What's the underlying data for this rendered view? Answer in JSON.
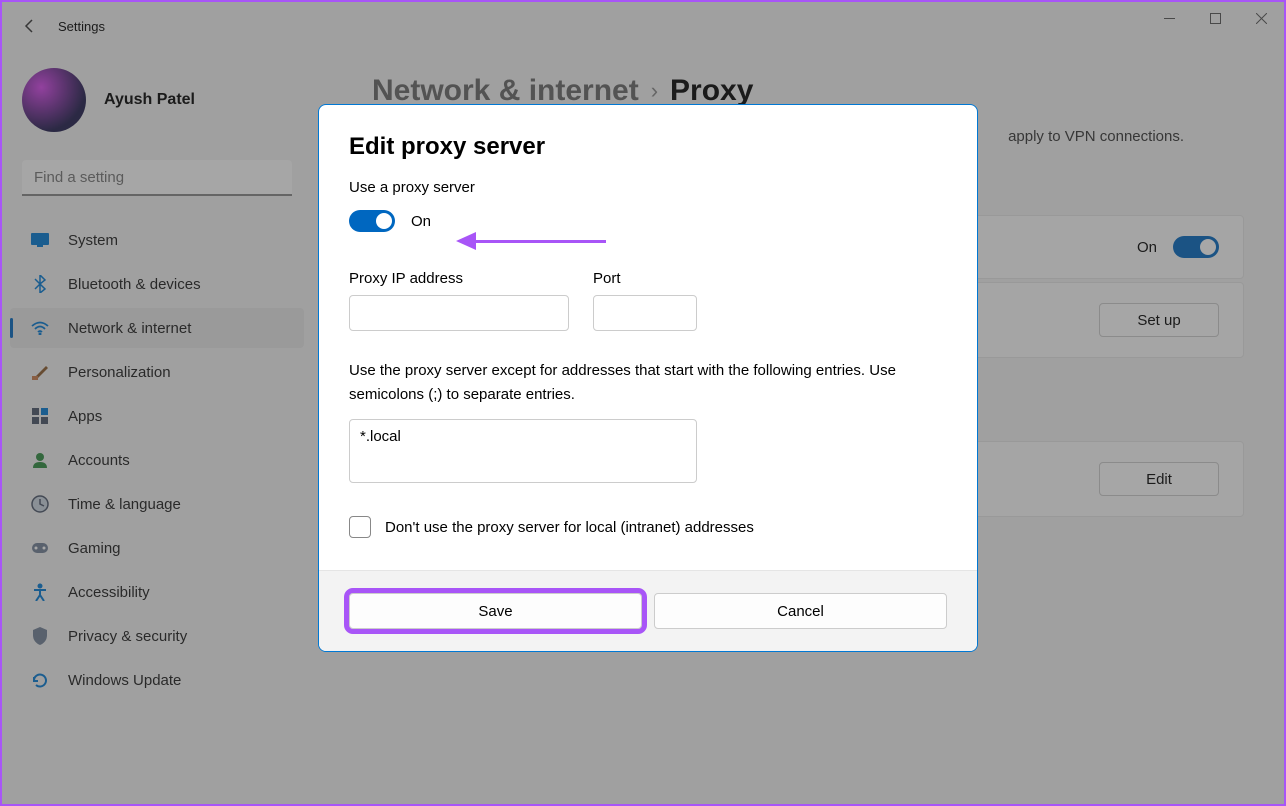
{
  "app_title": "Settings",
  "profile": {
    "name": "Ayush Patel"
  },
  "search": {
    "placeholder": "Find a setting"
  },
  "nav": {
    "items": [
      {
        "label": "System",
        "icon": "monitor"
      },
      {
        "label": "Bluetooth & devices",
        "icon": "bluetooth"
      },
      {
        "label": "Network & internet",
        "icon": "wifi",
        "active": true
      },
      {
        "label": "Personalization",
        "icon": "brush"
      },
      {
        "label": "Apps",
        "icon": "apps"
      },
      {
        "label": "Accounts",
        "icon": "person"
      },
      {
        "label": "Time & language",
        "icon": "clock"
      },
      {
        "label": "Gaming",
        "icon": "gamepad"
      },
      {
        "label": "Accessibility",
        "icon": "accessibility"
      },
      {
        "label": "Privacy & security",
        "icon": "shield"
      },
      {
        "label": "Windows Update",
        "icon": "update"
      }
    ]
  },
  "breadcrumb": {
    "parent": "Network & internet",
    "current": "Proxy"
  },
  "description_tail": "apply to VPN connections.",
  "bg_rows": {
    "row1": {
      "state": "On"
    },
    "row2": {
      "button": "Set up"
    },
    "row3": {
      "button": "Edit"
    }
  },
  "modal": {
    "title": "Edit proxy server",
    "use_proxy_label": "Use a proxy server",
    "toggle_state": "On",
    "ip_label": "Proxy IP address",
    "ip_value": "",
    "port_label": "Port",
    "port_value": "",
    "except_help": "Use the proxy server except for addresses that start with the following entries. Use semicolons (;) to separate entries.",
    "except_value": "*.local",
    "dont_use_local": "Don't use the proxy server for local (intranet) addresses",
    "save": "Save",
    "cancel": "Cancel"
  }
}
